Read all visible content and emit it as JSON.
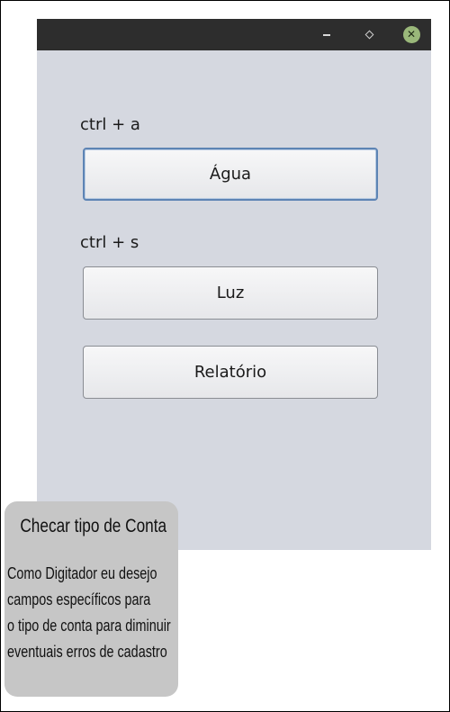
{
  "window": {
    "controls": {
      "minimize_icon": "minimize-icon",
      "maximize_icon": "maximize-icon",
      "close_icon": "close-icon",
      "close_glyph": "✕"
    }
  },
  "form": {
    "label_a": "ctrl + a",
    "button_agua": "Água",
    "label_s": "ctrl + s",
    "button_luz": "Luz",
    "button_relatorio": "Relatório"
  },
  "note": {
    "title": "Checar tipo de Conta",
    "lines": [
      "Como Digitador eu desejo",
      "campos específicos para",
      "o tipo de conta para diminuir",
      "eventuais erros de cadastro"
    ]
  },
  "colors": {
    "window_background": "#d5d8e0",
    "titlebar": "#2d2d2d",
    "close_button": "#9ab87a",
    "focus_border": "#5d84b4",
    "note_background": "#c6c6c6"
  }
}
